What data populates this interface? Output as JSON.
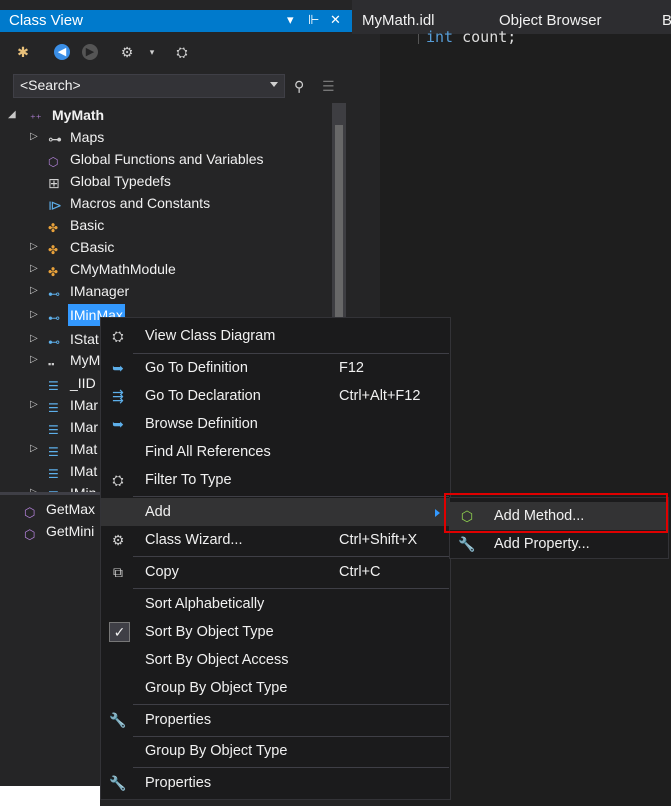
{
  "class_view": {
    "title": "Class View",
    "title_buttons": [
      "▾",
      "⊩",
      "✕"
    ],
    "search_placeholder": "<Search>",
    "tree": [
      {
        "label": "MyMath",
        "expander": "◢",
        "icon": "project-icon",
        "glyph": "⁺⁺"
      },
      {
        "label": "Maps",
        "expander": "▷",
        "icon": "key-icon",
        "glyph": "⊶"
      },
      {
        "label": "Global Functions and Variables",
        "expander": "",
        "icon": "cube-icon",
        "glyph": "⬡"
      },
      {
        "label": "Global Typedefs",
        "expander": "",
        "icon": "typedef-icon",
        "glyph": "⊞"
      },
      {
        "label": "Macros and Constants",
        "expander": "",
        "icon": "macro-icon",
        "glyph": "⧐"
      },
      {
        "label": "Basic",
        "expander": "",
        "icon": "class-icon",
        "glyph": "✤"
      },
      {
        "label": "CBasic",
        "expander": "▷",
        "icon": "class-icon",
        "glyph": "✤"
      },
      {
        "label": "CMyMathModule",
        "expander": "▷",
        "icon": "class-icon",
        "glyph": "✤"
      },
      {
        "label": "IManager",
        "expander": "▷",
        "icon": "interface-icon",
        "glyph": "⊷"
      },
      {
        "label": "IMinMax",
        "expander": "▷",
        "icon": "interface-icon",
        "glyph": "⊷"
      },
      {
        "label": "IStat",
        "expander": "▷",
        "icon": "interface-icon",
        "glyph": "⊷"
      },
      {
        "label": "MyM",
        "expander": "▷",
        "icon": "struct-icon",
        "glyph": "▪▪"
      },
      {
        "label": "_IID",
        "expander": "",
        "icon": "enum-icon",
        "glyph": "☰"
      },
      {
        "label": "IMar",
        "expander": "▷",
        "icon": "enum-icon",
        "glyph": "☰"
      },
      {
        "label": "IMar",
        "expander": "",
        "icon": "enum-icon",
        "glyph": "☰"
      },
      {
        "label": "IMat",
        "expander": "▷",
        "icon": "enum-icon",
        "glyph": "☰"
      },
      {
        "label": "IMat",
        "expander": "",
        "icon": "enum-icon",
        "glyph": "☰"
      },
      {
        "label": "IMin",
        "expander": "▷",
        "icon": "enum-icon",
        "glyph": "☰"
      }
    ],
    "members": [
      {
        "label": "GetMax",
        "glyph": "⬡"
      },
      {
        "label": "GetMini",
        "glyph": "⬡"
      }
    ]
  },
  "tabs": [
    {
      "label": "MyMath.idl"
    },
    {
      "label": "Object Browser"
    },
    {
      "label": "B"
    }
  ],
  "editor": {
    "keyword": "int",
    "text": " count;"
  },
  "context_menu": {
    "items": [
      {
        "label": "View Class Diagram",
        "shortcut": "",
        "glyph": "⛭"
      },
      {
        "label": "Go To Definition",
        "shortcut": "F12",
        "glyph": "➥"
      },
      {
        "label": "Go To Declaration",
        "shortcut": "Ctrl+Alt+F12",
        "glyph": "⇶"
      },
      {
        "label": "Browse Definition",
        "shortcut": "",
        "glyph": "➥"
      },
      {
        "label": "Find All References",
        "shortcut": "",
        "glyph": ""
      },
      {
        "label": "Filter To Type",
        "shortcut": "",
        "glyph": "⛭"
      },
      {
        "label": "Add",
        "shortcut": "",
        "glyph": ""
      },
      {
        "label": "Class Wizard...",
        "shortcut": "Ctrl+Shift+X",
        "glyph": "⚙"
      },
      {
        "label": "Copy",
        "shortcut": "Ctrl+C",
        "glyph": "⧉"
      },
      {
        "label": "Sort Alphabetically",
        "shortcut": "",
        "glyph": ""
      },
      {
        "label": "Sort By Object Type",
        "shortcut": "",
        "glyph": "✓"
      },
      {
        "label": "Sort By Object Access",
        "shortcut": "",
        "glyph": ""
      },
      {
        "label": "Group By Object Type",
        "shortcut": "",
        "glyph": ""
      },
      {
        "label": "Properties",
        "shortcut": "",
        "glyph": "🔧"
      },
      {
        "label": "Group By Object Type",
        "shortcut": "",
        "glyph": ""
      },
      {
        "label": "Properties",
        "shortcut": "",
        "glyph": "🔧"
      }
    ]
  },
  "submenu": {
    "items": [
      {
        "label": "Add Method...",
        "glyph": "⬡"
      },
      {
        "label": "Add Property...",
        "glyph": "🔧"
      }
    ]
  },
  "colors": {
    "accent": "#007acc",
    "selection": "#3399ff",
    "highlight_box": "#e00000",
    "menu_bg": "#1b1b1c"
  }
}
